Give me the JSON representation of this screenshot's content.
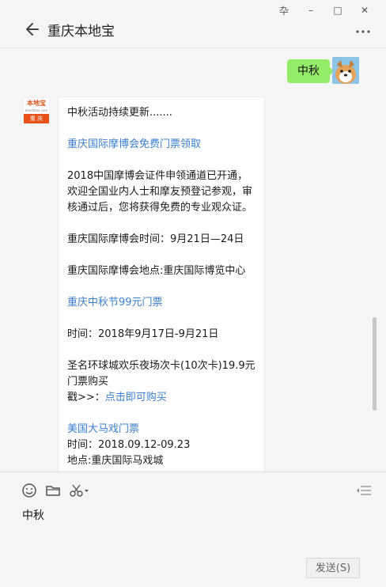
{
  "window": {
    "controls": [
      "pin-icon",
      "minimize-icon",
      "maximize-icon",
      "close-icon"
    ],
    "pin_label": "卆",
    "minimize_label": "–",
    "maximize_label": "□",
    "close_label": "✕"
  },
  "header": {
    "title": "重庆本地宝"
  },
  "messages": {
    "self": {
      "text": "中秋"
    },
    "bot": {
      "avatar_top": "本地宝",
      "avatar_sub": "bendibao.com",
      "avatar_bottom": "重 庆",
      "paragraphs": [
        "中秋活动持续更新.......",
        "重庆国际摩博会免费门票领取",
        "2018中国摩博会证件申领通道已开通，欢迎全国业内人士和摩友预登记参观，审核通过后，您将获得免费的专业观众证。",
        "重庆国际摩博会时间：9月21日—24日",
        "重庆国际摩博会地点:重庆国际博览中心",
        "重庆中秋节99元门票",
        "时间：2018年9月17日-9月21日",
        "圣名环球城欢乐夜场次卡(10次卡)19.9元门票购买",
        "戳>>：",
        "点击即可购买",
        "美国大马戏门票",
        "时间：2018.09.12-09.23",
        "地点:重庆国际马戏城"
      ]
    }
  },
  "input": {
    "value": "中秋",
    "send_label": "发送(S)"
  },
  "colors": {
    "self_bubble": "#95ec69",
    "link": "#3a7fd0"
  }
}
